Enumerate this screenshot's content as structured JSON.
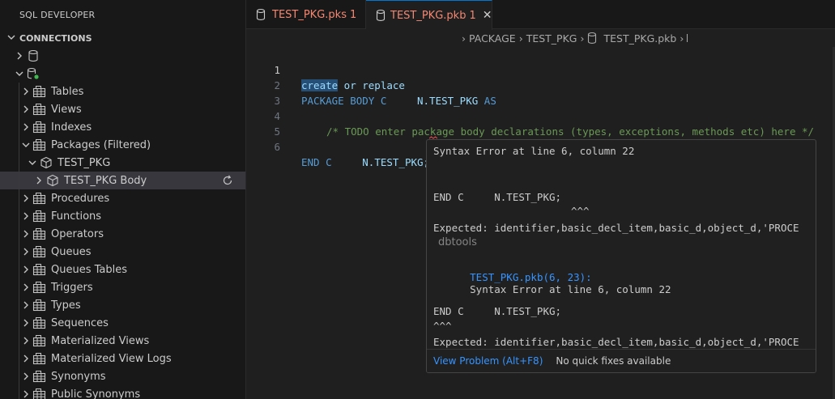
{
  "sidebar": {
    "title": "SQL DEVELOPER",
    "section": "CONNECTIONS",
    "items": [
      {
        "label": "Tables"
      },
      {
        "label": "Views"
      },
      {
        "label": "Indexes"
      },
      {
        "label": "Packages (Filtered)"
      },
      {
        "label": "TEST_PKG"
      },
      {
        "label": "TEST_PKG Body"
      },
      {
        "label": "Procedures"
      },
      {
        "label": "Functions"
      },
      {
        "label": "Operators"
      },
      {
        "label": "Queues"
      },
      {
        "label": "Queues Tables"
      },
      {
        "label": "Triggers"
      },
      {
        "label": "Types"
      },
      {
        "label": "Sequences"
      },
      {
        "label": "Materialized Views"
      },
      {
        "label": "Materialized View Logs"
      },
      {
        "label": "Synonyms"
      },
      {
        "label": "Public Synonyms"
      }
    ]
  },
  "tabs": [
    {
      "name": "TEST_PKG.pks",
      "problems": "1"
    },
    {
      "name": "TEST_PKG.pkb",
      "problems": "1"
    }
  ],
  "breadcrumb": {
    "parts": [
      "PACKAGE",
      "TEST_PKG",
      "TEST_PKG.pkb"
    ]
  },
  "editor": {
    "line_numbers": [
      "1",
      "2",
      "3",
      "4",
      "5",
      "6"
    ],
    "line1": {
      "sel": "create",
      "rest": " or replace"
    },
    "line2": {
      "kw": "PACKAGE BODY C",
      "mid": "N.TEST_PKG",
      "kw2": "AS"
    },
    "line4": {
      "comment": "/* TODO enter package body declarations (types, exceptions, methods etc) here */"
    },
    "line6": {
      "kw": "END C",
      "rest": "N.TEST_PKG;"
    }
  },
  "hover": {
    "msg1": "Syntax Error at line 6, column 22",
    "code1": "END C     N.TEST_PKG;",
    "caret1": "^^^",
    "expected1": "Expected: identifier,basic_decl_item,basic_d,object_d,'PROCE",
    "source": "dbtools",
    "link": "TEST_PKG.pkb(6, 23):",
    "msg2": "Syntax Error at line 6, column 22",
    "code2": "END C     N.TEST_PKG;",
    "caret2": "^^^",
    "expected2": "Expected: identifier,basic_decl_item,basic_d,object_d,'PROCE",
    "action": "View Problem (Alt+F8)",
    "nofix": "No quick fixes available"
  },
  "colors": {
    "accent": "#0078d4",
    "error_tab": "#f48771",
    "keyword": "#569cd6",
    "comment": "#6a9955",
    "link": "#3794ff"
  }
}
